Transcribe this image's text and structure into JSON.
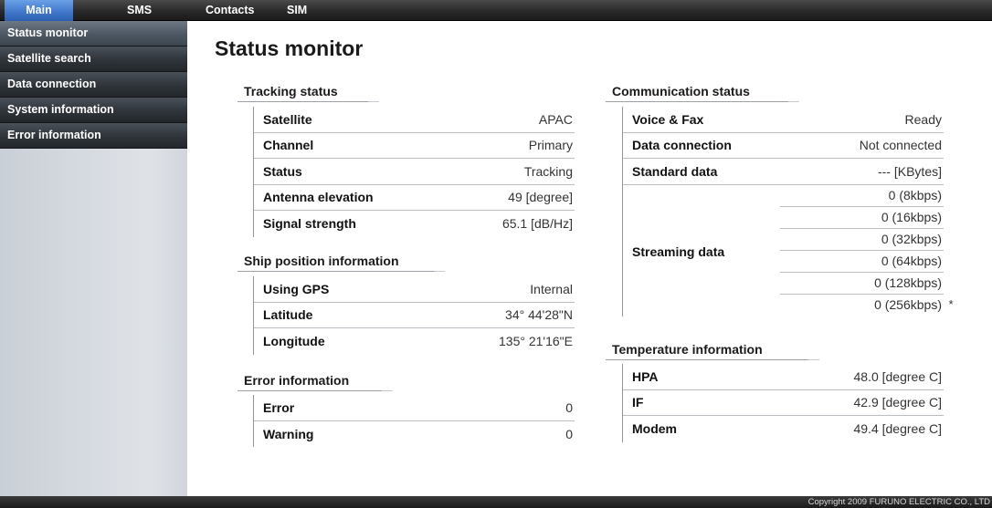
{
  "topbar": {
    "tabs": [
      "Main",
      "SMS",
      "Contacts",
      "SIM"
    ],
    "active_tab": "Main"
  },
  "sidebar": {
    "items": [
      "Status monitor",
      "Satellite search",
      "Data connection",
      "System information",
      "Error information"
    ],
    "selected": "Status monitor"
  },
  "main": {
    "title": "Status monitor",
    "tracking": {
      "title": "Tracking status",
      "rows": [
        {
          "label": "Satellite",
          "value": "APAC"
        },
        {
          "label": "Channel",
          "value": "Primary"
        },
        {
          "label": "Status",
          "value": "Tracking"
        },
        {
          "label": "Antenna elevation",
          "value": "49 [degree]"
        },
        {
          "label": "Signal strength",
          "value": "65.1 [dB/Hz]"
        }
      ]
    },
    "ship": {
      "title": "Ship position information",
      "rows": [
        {
          "label": "Using GPS",
          "value": "Internal"
        },
        {
          "label": "Latitude",
          "value": "34°  44'28\"N"
        },
        {
          "label": "Longitude",
          "value": "135°  21'16\"E"
        }
      ]
    },
    "error": {
      "title": "Error information",
      "rows": [
        {
          "label": "Error",
          "value": "0"
        },
        {
          "label": "Warning",
          "value": "0"
        }
      ]
    },
    "comm": {
      "title": "Communication status",
      "rows": [
        {
          "label": "Voice & Fax",
          "value": "Ready"
        },
        {
          "label": "Data connection",
          "value": "Not connected"
        },
        {
          "label": "Standard data",
          "value": "--- [KBytes]"
        }
      ],
      "streaming": {
        "label": "Streaming data",
        "values": [
          "0 (8kbps)",
          "0 (16kbps)",
          "0 (32kbps)",
          "0 (64kbps)",
          "0 (128kbps)",
          "0 (256kbps)"
        ],
        "asterisk": "*"
      }
    },
    "temp": {
      "title": "Temperature information",
      "rows": [
        {
          "label": "HPA",
          "value": "48.0 [degree C]"
        },
        {
          "label": "IF",
          "value": "42.9 [degree C]"
        },
        {
          "label": "Modem",
          "value": "49.4 [degree C]"
        }
      ]
    }
  },
  "footer": {
    "copyright": "Copyright 2009 FURUNO ELECTRIC CO., LTD"
  },
  "colors": {
    "active_tab": "#3f76c9",
    "sidebar_item": "#2f343a",
    "sidebar_bg": "#dfe3e8"
  }
}
